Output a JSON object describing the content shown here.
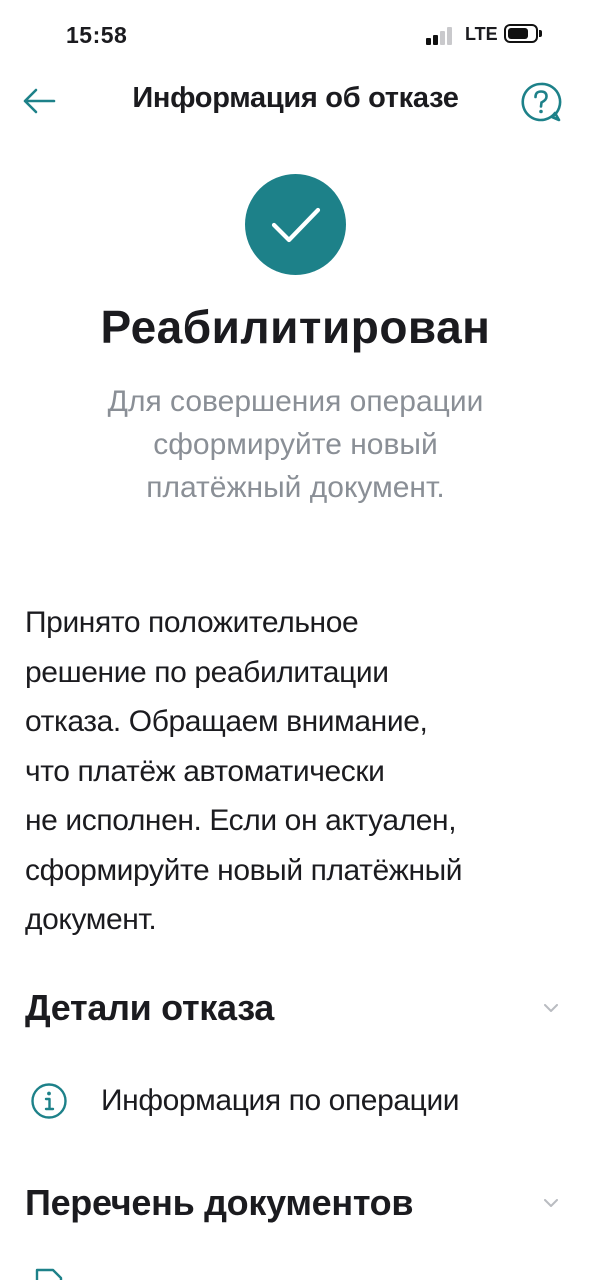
{
  "status_bar": {
    "time": "15:58",
    "network": "LTE"
  },
  "header": {
    "title": "Информация об отказе",
    "back_icon": "arrow-left-icon",
    "help_icon": "question-bubble-icon"
  },
  "status": {
    "icon": "check-icon",
    "title": "Реабилитирован",
    "subtitle_lines": [
      "Для совершения операции",
      "сформируйте новый",
      "платёжный документ."
    ]
  },
  "message_lines": [
    "Принято положительное",
    "решение по реабилитации",
    "отказа. Обращаем внимание,",
    "что платёж автоматически",
    "не исполнен. Если он актуален,",
    "сформируйте новый платёжный",
    "документ."
  ],
  "sections": {
    "details": {
      "title": "Детали отказа",
      "items": [
        {
          "label": "Информация по операции",
          "icon": "info-icon"
        }
      ]
    },
    "documents": {
      "title": "Перечень документов"
    }
  },
  "colors": {
    "accent": "#1d8189",
    "text": "#1b1b1f",
    "muted": "#8a8f96",
    "chevron": "#b9bcc1"
  }
}
